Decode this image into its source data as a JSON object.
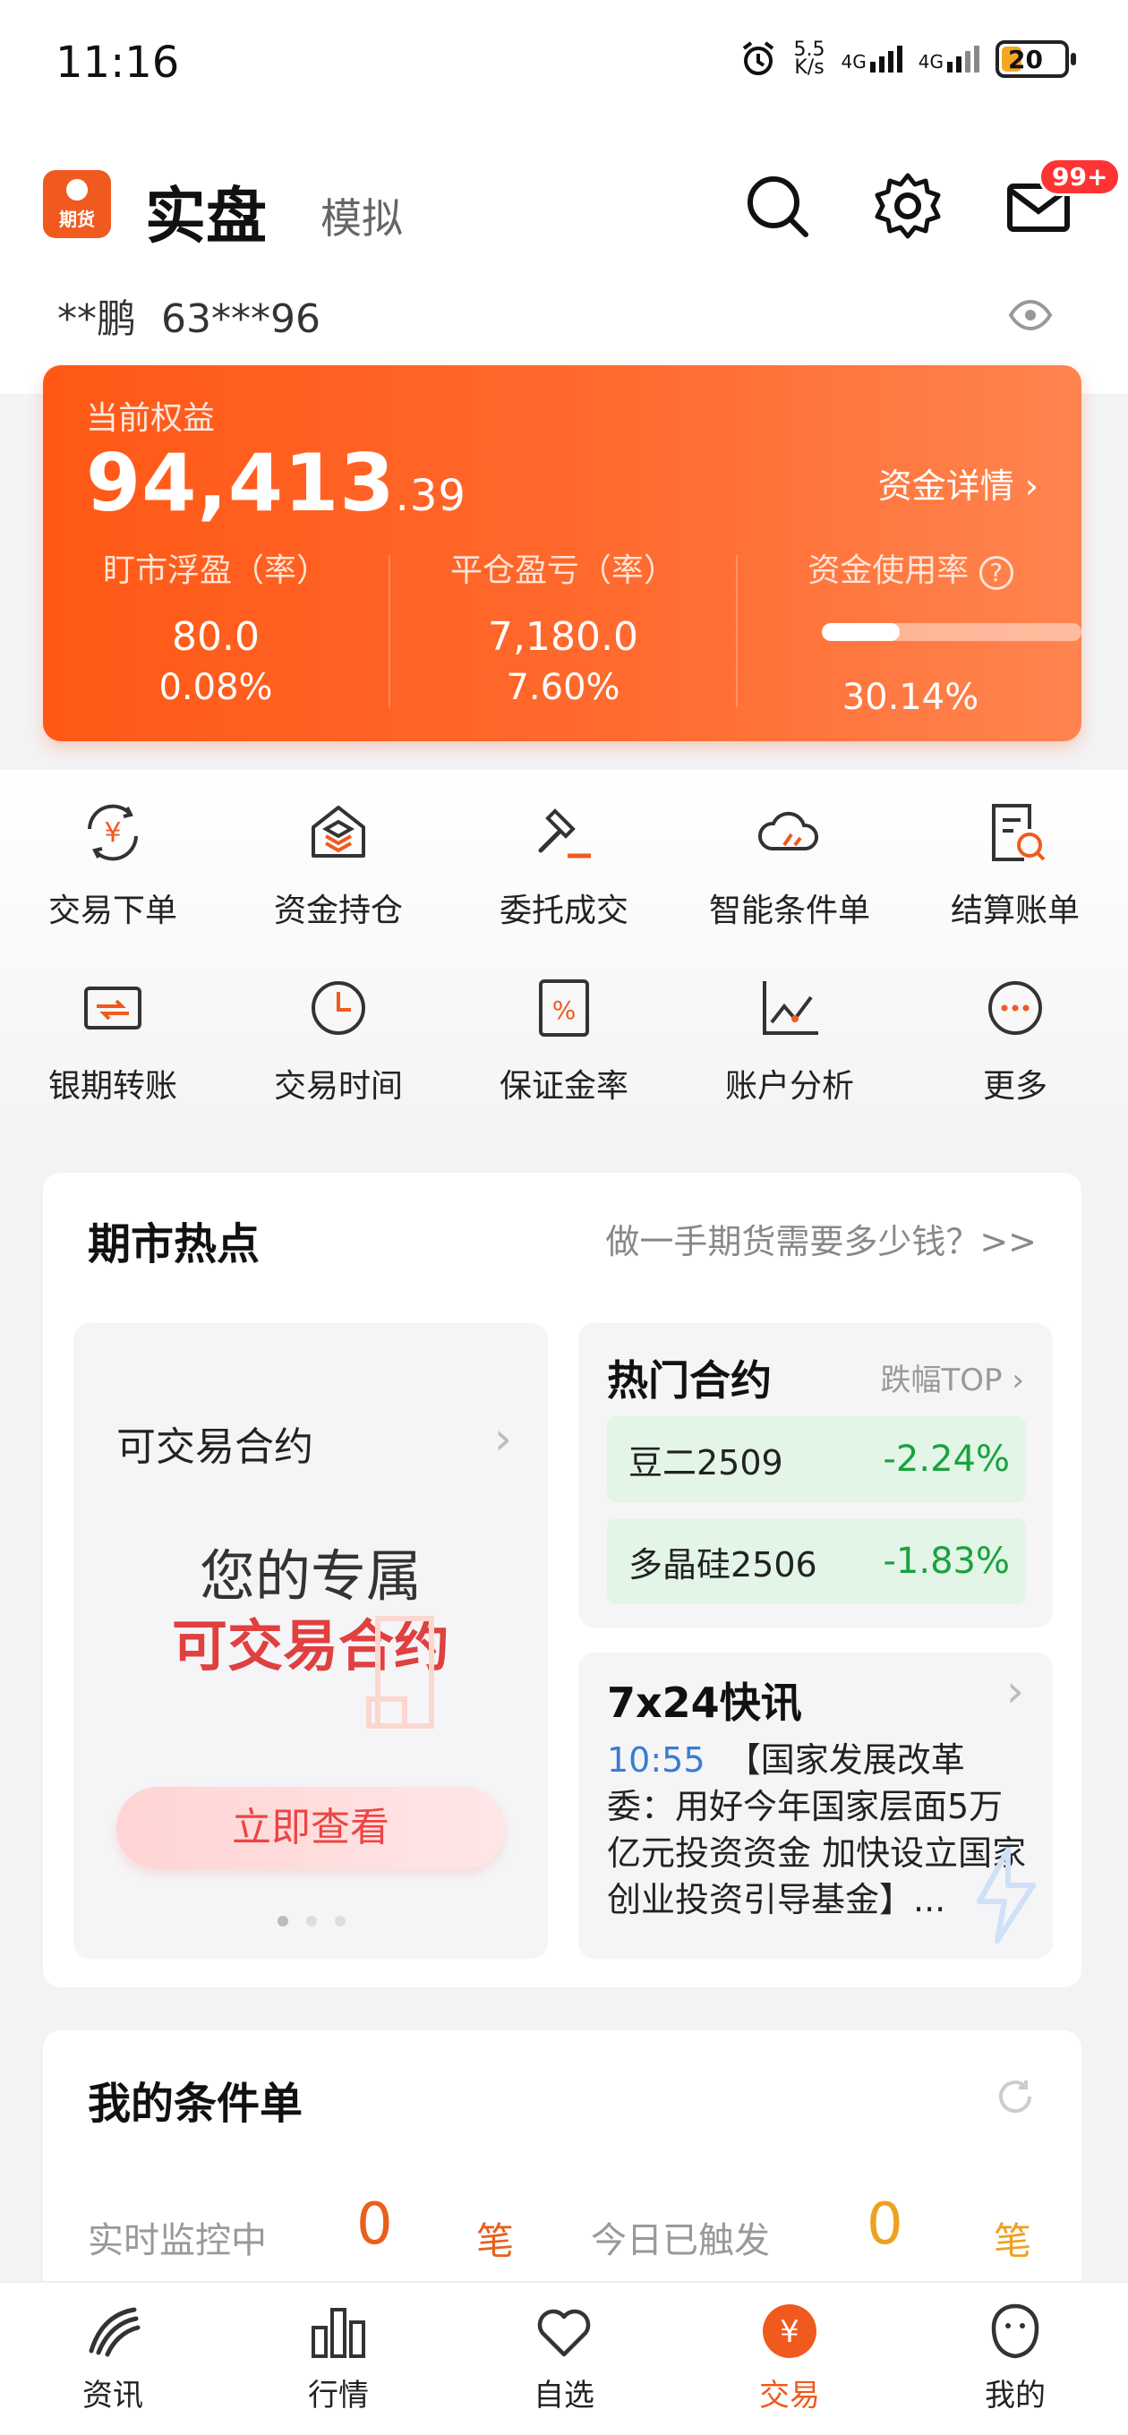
{
  "status_bar": {
    "time": "11:16",
    "net_speed_top": "5.5",
    "net_speed_unit": "K/s",
    "sig1": "4G",
    "sig2": "4G",
    "battery": "20"
  },
  "header": {
    "logo_text": "期货",
    "tab_real": "实盘",
    "tab_sim": "模拟",
    "badge": "99+",
    "account_name": "**鹏",
    "account_id": "63***96"
  },
  "equity": {
    "label": "当前权益",
    "value_int": "94,413",
    "value_dec": ".39",
    "detail_link": "资金详情",
    "stats": [
      {
        "label": "盯市浮盈（率）",
        "v1": "80.0",
        "v2": "0.08%"
      },
      {
        "label": "平仓盈亏（率）",
        "v1": "7,180.0",
        "v2": "7.60%"
      },
      {
        "label": "资金使用率",
        "v2": "30.14%"
      }
    ],
    "usage_fraction": 0.3014
  },
  "grid": [
    {
      "label": "交易下单",
      "icon": "yen-exchange-icon"
    },
    {
      "label": "资金持仓",
      "icon": "house-stack-icon"
    },
    {
      "label": "委托成交",
      "icon": "gavel-icon"
    },
    {
      "label": "智能条件单",
      "icon": "cloud-icon"
    },
    {
      "label": "结算账单",
      "icon": "bill-search-icon"
    },
    {
      "label": "银期转账",
      "icon": "card-transfer-icon"
    },
    {
      "label": "交易时间",
      "icon": "clock-icon"
    },
    {
      "label": "保证金率",
      "icon": "percent-icon"
    },
    {
      "label": "账户分析",
      "icon": "line-chart-icon"
    },
    {
      "label": "更多",
      "icon": "more-icon"
    }
  ],
  "hot": {
    "title": "期市热点",
    "link": "做一手期货需要多少钱？>>",
    "left": {
      "title": "可交易合约",
      "line1": "您的专属",
      "line2": "可交易合约",
      "button": "立即查看"
    },
    "contracts": {
      "title": "热门合约",
      "link": "跌幅TOP",
      "rows": [
        {
          "name": "豆二2509",
          "pct": "-2.24%"
        },
        {
          "name": "多晶硅2506",
          "pct": "-1.83%"
        }
      ]
    },
    "news": {
      "title": "7x24快讯",
      "time": "10:55",
      "text": "【国家发展改革委：用好今年国家层面5万亿元投资资金 加快设立国家创业投资引导基金】..."
    }
  },
  "conditions": {
    "title": "我的条件单",
    "monitoring_label": "实时监控中",
    "monitoring_count": "0",
    "monitoring_unit": "笔",
    "triggered_label": "今日已触发",
    "triggered_count": "0",
    "triggered_unit": "笔"
  },
  "tabbar": [
    {
      "label": "资讯",
      "icon": "news-icon"
    },
    {
      "label": "行情",
      "icon": "bar-chart-icon"
    },
    {
      "label": "自选",
      "icon": "heart-icon"
    },
    {
      "label": "交易",
      "icon": "yen-circle-icon"
    },
    {
      "label": "我的",
      "icon": "profile-icon"
    }
  ],
  "colors": {
    "accent": "#f05a1e",
    "green": "#19a23f",
    "red": "#e44444"
  }
}
